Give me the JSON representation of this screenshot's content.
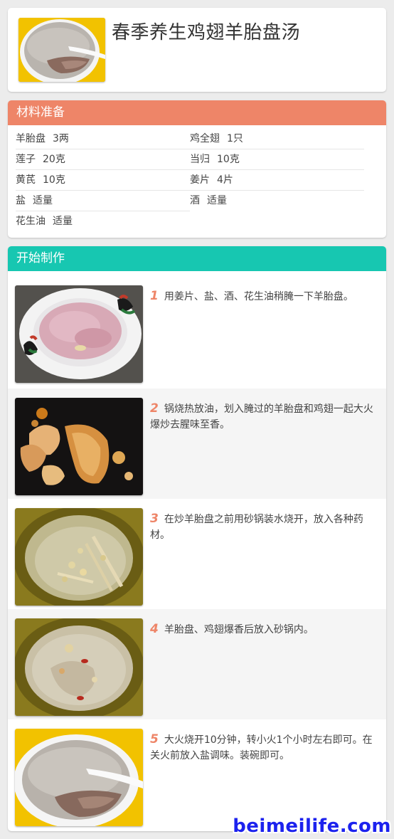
{
  "recipe": {
    "title": "春季养生鸡翅羊胎盘汤",
    "thumbnail_icon": "finished-soup-bowl-photo"
  },
  "ingredients": {
    "heading": "材料准备",
    "rows": [
      [
        {
          "name": "羊胎盘",
          "amount": "3两"
        },
        {
          "name": "鸡全翅",
          "amount": "1只"
        }
      ],
      [
        {
          "name": "莲子",
          "amount": "20克"
        },
        {
          "name": "当归",
          "amount": "10克"
        }
      ],
      [
        {
          "name": "黄芪",
          "amount": "10克"
        },
        {
          "name": "姜片",
          "amount": "4片"
        }
      ],
      [
        {
          "name": "盐",
          "amount": "适量"
        },
        {
          "name": "酒",
          "amount": "适量"
        }
      ],
      [
        {
          "name": "花生油",
          "amount": "适量"
        }
      ]
    ]
  },
  "steps": {
    "heading": "开始制作",
    "items": [
      {
        "num": "1",
        "text": "用姜片、盐、酒、花生油稍腌一下羊胎盘。",
        "photo": "marinated-placenta-photo"
      },
      {
        "num": "2",
        "text": "锅烧热放油，划入腌过的羊胎盘和鸡翅一起大火爆炒去腥味至香。",
        "photo": "stir-fry-wok-photo"
      },
      {
        "num": "3",
        "text": "在炒羊胎盘之前用砂锅装水烧开，放入各种药材。",
        "photo": "herbs-in-claypot-photo"
      },
      {
        "num": "4",
        "text": "羊胎盘、鸡翅爆香后放入砂锅内。",
        "photo": "claypot-soup-photo"
      },
      {
        "num": "5",
        "text": "大火烧开10分钟，转小火1个小时左右即可。在关火前放入盐调味。装碗即可。",
        "photo": "served-soup-photo"
      }
    ]
  },
  "watermark": "beimeilife.com",
  "colors": {
    "ingredients_bar": "#ee8568",
    "steps_bar": "#17c7b1",
    "step_number": "#ee8568",
    "watermark": "#1c22ee"
  }
}
